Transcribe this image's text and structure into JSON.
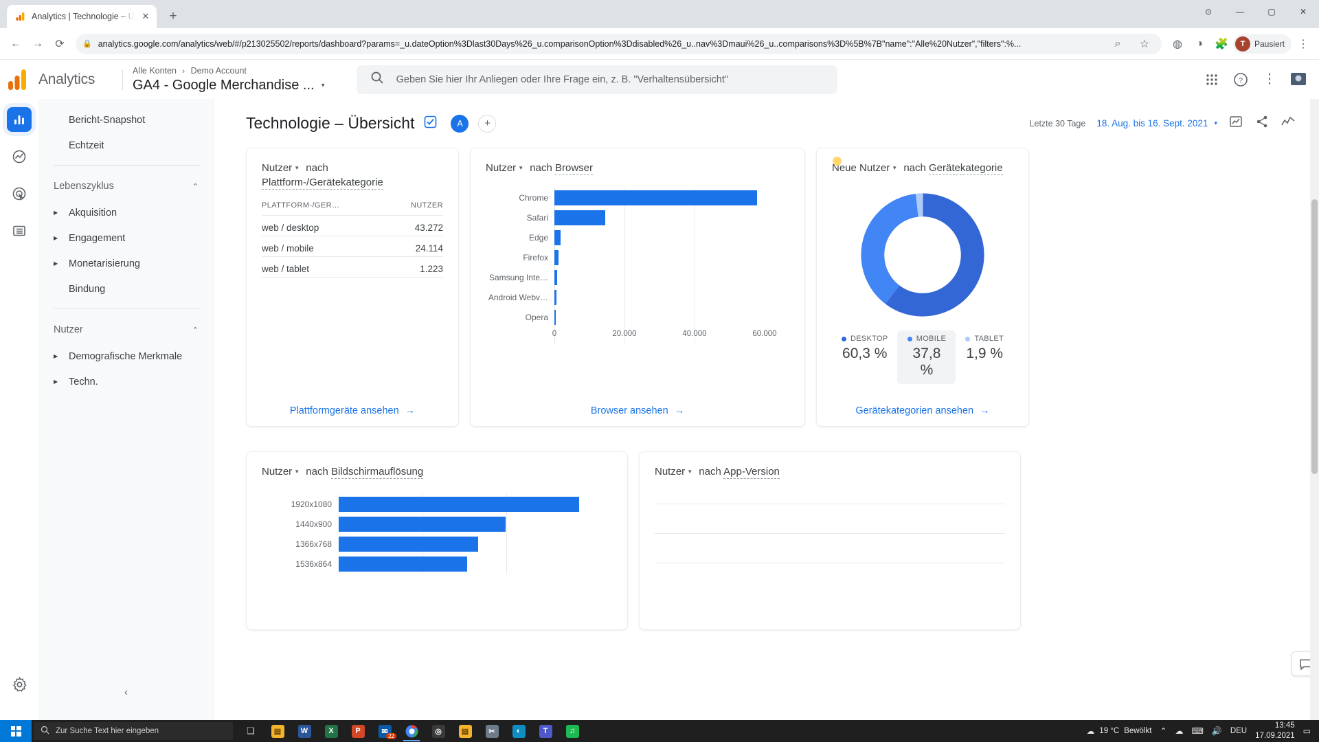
{
  "browser": {
    "tab_title": "Analytics | Technologie – Übersic",
    "tab_close": "✕",
    "new_tab": "+",
    "url": "analytics.google.com/analytics/web/#/p213025502/reports/dashboard?params=_u.dateOption%3Dlast30Days%26_u.comparisonOption%3Ddisabled%26_u..nav%3Dmaui%26_u..comparisons%3D%5B%7B\"name\":\"Alle%20Nutzer\",\"filters\":%...",
    "profile_label": "Pausiert",
    "profile_initial": "T",
    "back_icon": "←",
    "forward_icon": "→",
    "reload_icon": "⟳",
    "lock_icon": "🔒",
    "zoom_icon": "⌕",
    "star_icon": "☆",
    "win_minimize": "—",
    "win_maximize": "▢",
    "win_close": "✕"
  },
  "ga_header": {
    "wordmark": "Analytics",
    "breadcrumb_account": "Alle Konten",
    "breadcrumb_sep": "›",
    "breadcrumb_property": "Demo Account",
    "property_name": "GA4 - Google Merchandise ...",
    "search_placeholder": "Geben Sie hier Ihr Anliegen oder Ihre Frage ein, z. B. \"Verhaltensübersicht\"",
    "icons": [
      "apps-grid-icon",
      "help-icon",
      "more-vert-icon",
      "account-avatar"
    ]
  },
  "rail": {
    "items": [
      {
        "name": "reports-icon",
        "glyph": "▥",
        "active": true
      },
      {
        "name": "explore-icon",
        "glyph": "◍",
        "active": false
      },
      {
        "name": "advertising-icon",
        "glyph": "◎",
        "active": false
      },
      {
        "name": "configure-icon",
        "glyph": "☰",
        "active": false
      }
    ],
    "settings_glyph": "⚙"
  },
  "sidebar": {
    "top_items": [
      {
        "label": "Bericht-Snapshot",
        "arrow": false
      },
      {
        "label": "Echtzeit",
        "arrow": false
      }
    ],
    "group_lifecycle": {
      "label": "Lebenszyklus",
      "chevron": "⌃"
    },
    "lifecycle_items": [
      {
        "label": "Akquisition",
        "arrow": true
      },
      {
        "label": "Engagement",
        "arrow": true
      },
      {
        "label": "Monetarisierung",
        "arrow": true
      },
      {
        "label": "Bindung",
        "arrow": false
      }
    ],
    "group_users": {
      "label": "Nutzer",
      "chevron": "⌃"
    },
    "user_items": [
      {
        "label": "Demografische Merkmale",
        "arrow": true
      },
      {
        "label": "Techn.",
        "arrow": true
      }
    ],
    "collapse_icon": "‹"
  },
  "page": {
    "title": "Technologie – Übersicht",
    "verified_icon": "verified-icon",
    "avatar_letter": "A",
    "add_icon": "+",
    "date_prefix": "Letzte 30 Tage",
    "date_range": "18. Aug. bis 16. Sept. 2021",
    "date_caret": "▾",
    "actions": [
      "compare-icon",
      "share-icon",
      "insights-icon"
    ]
  },
  "cards": {
    "platform": {
      "title_metric": "Nutzer",
      "title_by": "nach",
      "title_dim": "Plattform-/Gerätekategorie",
      "col_dim": "PLATTFORM-/GER…",
      "col_metric": "NUTZER",
      "rows": [
        {
          "label": "web / desktop",
          "value": "43.272",
          "pct": 100
        },
        {
          "label": "web / mobile",
          "value": "24.114",
          "pct": 35
        },
        {
          "label": "web / tablet",
          "value": "1.223",
          "pct": 3
        }
      ],
      "footer": "Plattformgeräte ansehen",
      "footer_arrow": "→"
    },
    "browser": {
      "title_metric": "Nutzer",
      "title_by": "nach",
      "title_dim": "Browser",
      "footer": "Browser ansehen",
      "footer_arrow": "→"
    },
    "device": {
      "title_metric": "Neue Nutzer",
      "title_by": "nach",
      "title_dim": "Gerätekategorie",
      "footer": "Gerätekategorien ansehen",
      "footer_arrow": "→"
    },
    "resolution": {
      "title_metric": "Nutzer",
      "title_by": "nach",
      "title_dim": "Bildschirmauflösung"
    },
    "appversion": {
      "title_metric": "Nutzer",
      "title_by": "nach",
      "title_dim": "App-Version"
    }
  },
  "chart_data": [
    {
      "type": "bar",
      "orientation": "horizontal",
      "title": "Nutzer nach Browser",
      "categories": [
        "Chrome",
        "Safari",
        "Edge",
        "Firefox",
        "Samsung Inte…",
        "Android Webv…",
        "Opera"
      ],
      "values": [
        51800,
        13000,
        1600,
        1100,
        700,
        500,
        260
      ],
      "xlabel": "",
      "ylabel": "",
      "xlim": [
        0,
        60000
      ],
      "xticks": [
        "0",
        "20.000",
        "40.000",
        "60.000"
      ],
      "grid": true,
      "color": "#1a73e8"
    },
    {
      "type": "pie",
      "subtype": "donut",
      "title": "Neue Nutzer nach Gerätekategorie",
      "labels": [
        "DESKTOP",
        "MOBILE",
        "TABLET"
      ],
      "values": [
        60.3,
        37.8,
        1.9
      ],
      "value_labels": [
        "60,3 %",
        "37,8 %",
        "1,9 %"
      ],
      "colors": [
        "#3367d6",
        "#4285f4",
        "#aecbfa"
      ],
      "legend": "bottom",
      "highlighted": "MOBILE"
    },
    {
      "type": "bar",
      "orientation": "horizontal",
      "title": "Nutzer nach Bildschirmauflösung",
      "categories": [
        "1920x1080",
        "1440x900",
        "1366x768",
        "1536x864"
      ],
      "values": [
        8800,
        6000,
        5000,
        4700
      ],
      "xlabel": "",
      "ylabel": "",
      "grid": true,
      "color": "#1a73e8"
    }
  ],
  "fab": {
    "icon": "feedback-icon"
  },
  "taskbar": {
    "search_placeholder": "Zur Suche Text hier eingeben",
    "search_icon": "🔍",
    "apps": [
      {
        "name": "task-view",
        "glyph": "❏",
        "color": "transparent"
      },
      {
        "name": "file-explorer",
        "glyph": "▤",
        "color": "#f5b22d"
      },
      {
        "name": "word",
        "glyph": "W",
        "color": "#2b579a"
      },
      {
        "name": "excel",
        "glyph": "X",
        "color": "#217346"
      },
      {
        "name": "powerpoint",
        "glyph": "P",
        "color": "#d24726"
      },
      {
        "name": "mail",
        "glyph": "✉",
        "color": "#0a5ca8",
        "badge": "22"
      },
      {
        "name": "chrome",
        "glyph": "◉",
        "color": "#4285f4",
        "active": true
      },
      {
        "name": "obs",
        "glyph": "◎",
        "color": "#3a3a3a"
      },
      {
        "name": "explorer2",
        "glyph": "▤",
        "color": "#f5b22d"
      },
      {
        "name": "snipping-tool",
        "glyph": "✂",
        "color": "#6e7b8b"
      },
      {
        "name": "edge",
        "glyph": "◐",
        "color": "#0f8ec4"
      },
      {
        "name": "teams",
        "glyph": "T",
        "color": "#5059c9"
      },
      {
        "name": "spotify",
        "glyph": "♫",
        "color": "#1db954"
      }
    ],
    "weather_temp": "19 °C",
    "weather_desc": "Bewölkt",
    "weather_icon": "☁",
    "tray_icons": [
      "chevron-up-icon",
      "onedrive-icon",
      "network-icon",
      "volume-icon"
    ],
    "lang": "DEU",
    "time": "13:45",
    "date": "17.09.2021"
  }
}
